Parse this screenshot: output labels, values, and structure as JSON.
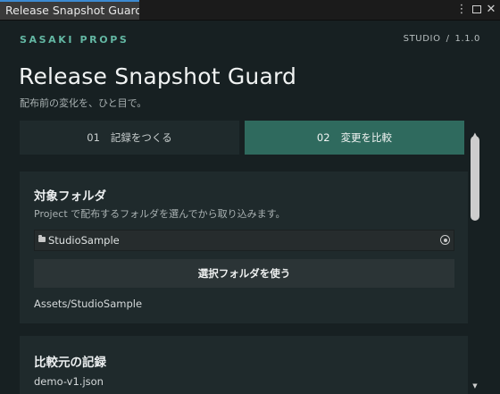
{
  "window": {
    "tab_title": "Release Snapshot Guard"
  },
  "header": {
    "brand": "SASAKI PROPS",
    "studio_label": "STUDIO",
    "separator": "/",
    "version": "1.1.0",
    "title": "Release Snapshot Guard",
    "subtitle": "配布前の変化を、ひと目で。"
  },
  "tabs": [
    {
      "number": "01",
      "label": "記録をつくる",
      "selected": false
    },
    {
      "number": "02",
      "label": "変更を比較",
      "selected": true
    }
  ],
  "target_folder": {
    "title": "対象フォルダ",
    "description": "Project で配布するフォルダを選んでから取り込みます。",
    "field_value": "StudioSample",
    "use_button_label": "選択フォルダを使う",
    "path": "Assets/StudioSample"
  },
  "source_snapshot": {
    "title": "比較元の記録",
    "file": "demo-v1.json"
  },
  "icons": {
    "folder": "folder-icon",
    "picker": "object-picker-icon",
    "kebab": "kebab-menu-icon",
    "restore": "maximize-icon",
    "close": "close-icon"
  },
  "colors": {
    "accent": "#63b7a3",
    "selected_tab": "#2f6a5e",
    "background": "#172022",
    "card": "#1f2a2c"
  }
}
